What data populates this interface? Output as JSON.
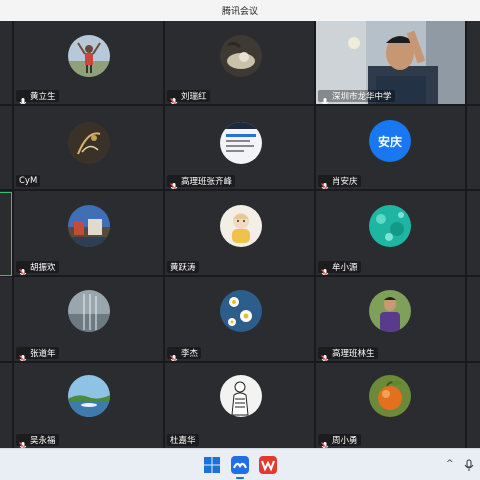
{
  "window": {
    "title": "腾讯会议"
  },
  "participants": [
    {
      "name": "黄立生",
      "mic": "on"
    },
    {
      "name": "刘瑞红",
      "mic": "muted"
    },
    {
      "name": "深圳市龙华中学",
      "mic": "on"
    },
    {
      "name": "CyM",
      "mic": "none"
    },
    {
      "name": "高理班张齐峰",
      "mic": "muted"
    },
    {
      "name": "肖安庆",
      "mic": "muted",
      "avatar_text": "安庆"
    },
    {
      "name": "胡振欢",
      "mic": "muted"
    },
    {
      "name": "黄跃涛",
      "mic": "none"
    },
    {
      "name": "牟小源",
      "mic": "muted"
    },
    {
      "name": "张道年",
      "mic": "muted"
    },
    {
      "name": "李杰",
      "mic": "muted"
    },
    {
      "name": "高理班林生",
      "mic": "muted"
    },
    {
      "name": "吴永福",
      "mic": "muted"
    },
    {
      "name": "杜嘉华",
      "mic": "none"
    },
    {
      "name": "周小勇",
      "mic": "muted"
    }
  ],
  "taskbar": {
    "items": [
      "windows-start",
      "tencent-meeting",
      "wps-office"
    ],
    "system_tray": [
      "^"
    ]
  },
  "colors": {
    "tile_bg": "#2b2c30",
    "grid_bg": "#191a1d",
    "active_speaker_border": "#2fc46b",
    "avatar_text_bg": "#1778f2"
  }
}
